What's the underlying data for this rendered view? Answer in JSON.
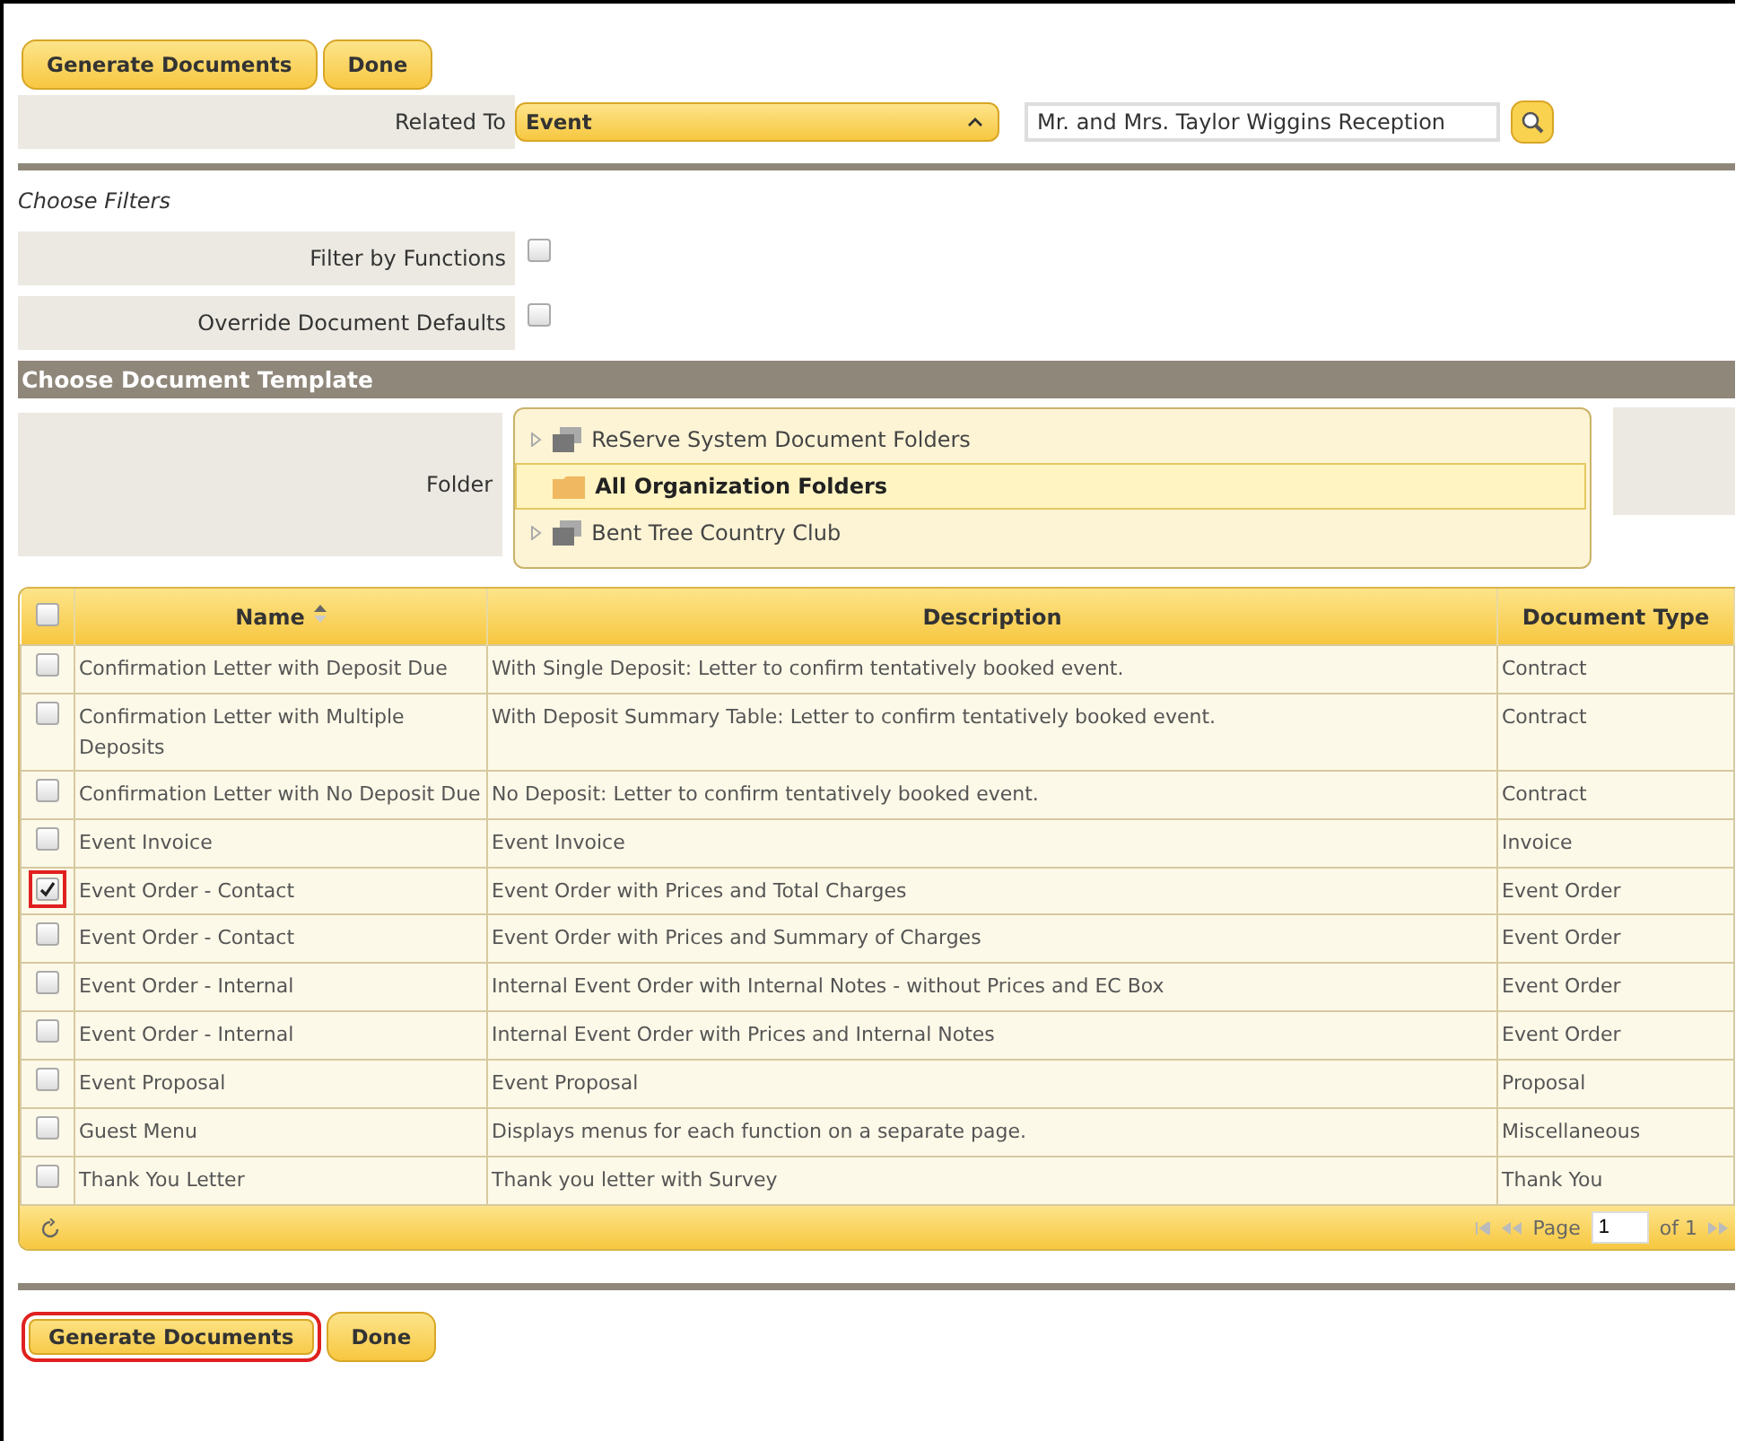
{
  "top_buttons": [
    {
      "label": "Generate Documents",
      "highlighted": false
    },
    {
      "label": "Done",
      "highlighted": false
    }
  ],
  "related_to": {
    "label": "Related To",
    "value": "Event",
    "search_value": "Mr. and Mrs. Taylor Wiggins Reception"
  },
  "filters": {
    "title": "Choose Filters",
    "options": [
      {
        "label": "Filter by Functions",
        "checked": false
      },
      {
        "label": "Override Document Defaults",
        "checked": false
      }
    ]
  },
  "template": {
    "title": "Choose Document Template",
    "folder_label": "Folder",
    "folders": [
      {
        "name": "ReServe System Document Folders",
        "expandable": true,
        "selected": false
      },
      {
        "name": "All Organization Folders",
        "expandable": false,
        "selected": true
      },
      {
        "name": "Bent Tree Country Club",
        "expandable": true,
        "selected": false
      }
    ]
  },
  "table": {
    "all_checked": false,
    "columns": [
      {
        "label": "Name",
        "sortable": true
      },
      {
        "label": "Description",
        "sortable": false
      },
      {
        "label": "Document Type",
        "sortable": false
      }
    ],
    "rows": [
      {
        "name": "Confirmation Letter with Deposit Due",
        "description": "With Single Deposit: Letter to confirm tentatively booked event.",
        "type": "Contract",
        "checked": false,
        "highlighted": false
      },
      {
        "name": "Confirmation Letter with Multiple Deposits",
        "description": "With Deposit Summary Table: Letter to confirm tentatively booked event.",
        "type": "Contract",
        "checked": false,
        "highlighted": false
      },
      {
        "name": "Confirmation Letter with No Deposit Due",
        "description": "No Deposit: Letter to confirm tentatively booked event.",
        "type": "Contract",
        "checked": false,
        "highlighted": false
      },
      {
        "name": "Event Invoice",
        "description": "Event Invoice",
        "type": "Invoice",
        "checked": false,
        "highlighted": false
      },
      {
        "name": "Event Order - Contact",
        "description": "Event Order with Prices and Total Charges",
        "type": "Event Order",
        "checked": true,
        "highlighted": true
      },
      {
        "name": "Event Order - Contact",
        "description": "Event Order with Prices and Summary of Charges",
        "type": "Event Order",
        "checked": false,
        "highlighted": false
      },
      {
        "name": "Event Order - Internal",
        "description": "Internal Event Order with Internal Notes - without Prices and EC Box",
        "type": "Event Order",
        "checked": false,
        "highlighted": false
      },
      {
        "name": "Event Order - Internal",
        "description": "Internal Event Order with Prices and Internal Notes",
        "type": "Event Order",
        "checked": false,
        "highlighted": false
      },
      {
        "name": "Event Proposal",
        "description": "Event Proposal",
        "type": "Proposal",
        "checked": false,
        "highlighted": false
      },
      {
        "name": "Guest Menu",
        "description": "Displays menus for each function on a separate page.",
        "type": "Miscellaneous",
        "checked": false,
        "highlighted": false
      },
      {
        "name": "Thank You Letter",
        "description": "Thank you letter with Survey",
        "type": "Thank You",
        "checked": false,
        "highlighted": false
      }
    ]
  },
  "pager": {
    "page_label": "Page",
    "page": "1",
    "of": "of 1"
  },
  "bottom_buttons": [
    {
      "label": "Generate Documents",
      "highlighted": true
    },
    {
      "label": "Done",
      "highlighted": false
    }
  ]
}
